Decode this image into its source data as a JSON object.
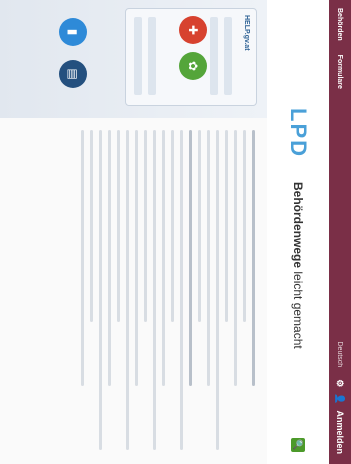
{
  "topbar": {
    "nav": [
      "Behörden",
      "Formulare"
    ],
    "lang": "Deutsch",
    "login": "Anmelden"
  },
  "header": {
    "logo_text": "LPD",
    "logo_small": "HELP.gv.at",
    "tagline_strong": "Behördenwege",
    "tagline_rest": "leicht gemacht",
    "search_icon": "search-icon"
  },
  "promo": {
    "app_label": "HELP",
    "icons": [
      "id-card-icon",
      "leaf-icon",
      "book-icon",
      "document-icon"
    ]
  }
}
